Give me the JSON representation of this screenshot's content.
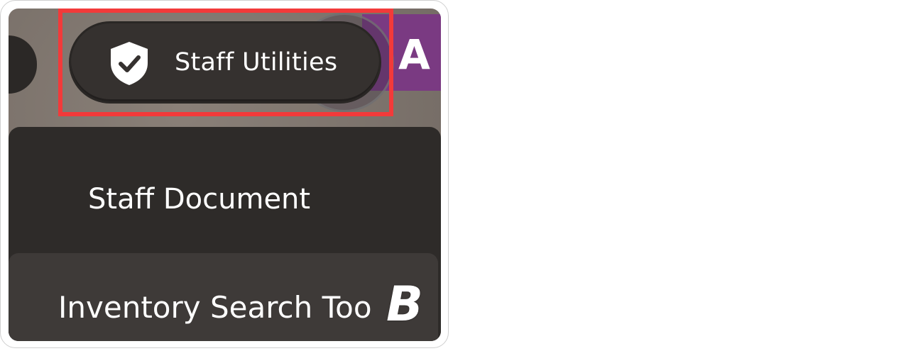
{
  "header": {
    "staff_utilities_label": "Staff Utilities",
    "partial_tab_text": "A"
  },
  "menu": {
    "items": [
      {
        "label": "Staff Document"
      },
      {
        "label": "Inventory Search Too"
      }
    ]
  },
  "watermark": {
    "text": "B"
  },
  "icons": {
    "shield": "shield-check-icon"
  },
  "colors": {
    "highlight_border": "#f23a3a",
    "button_bg": "#35312f",
    "menu_bg": "#2e2b29",
    "purple_tab": "#7a3a82"
  }
}
